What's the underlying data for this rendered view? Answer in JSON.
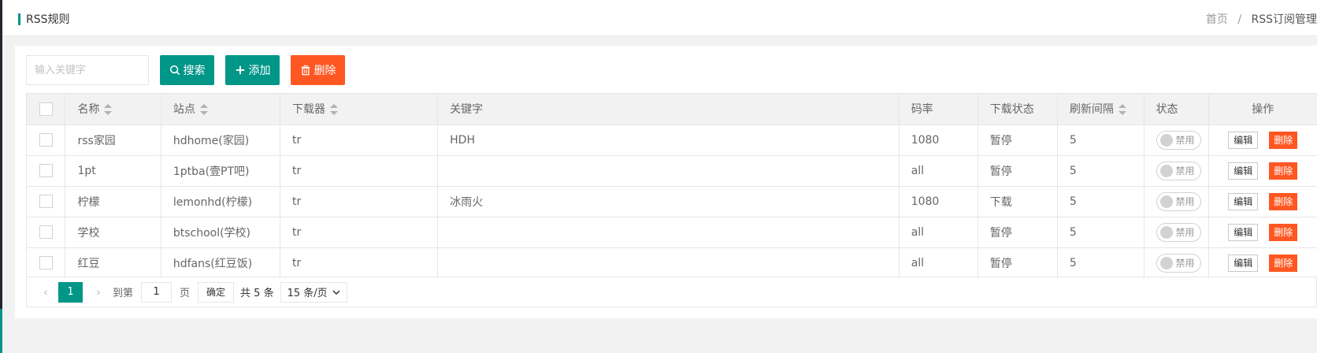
{
  "header": {
    "title": "RSS规则",
    "breadcrumb": [
      "首页",
      "RSS订阅管理"
    ],
    "separator": "/"
  },
  "toolbar": {
    "search_placeholder": "输入关键字",
    "search_label": "搜索",
    "add_label": "添加",
    "delete_label": "删除"
  },
  "table": {
    "columns": [
      "名称",
      "站点",
      "下载器",
      "关键字",
      "码率",
      "下载状态",
      "刷新间隔",
      "状态",
      "操作"
    ],
    "rows": [
      {
        "name": "rss家园",
        "site": "hdhome(家园)",
        "downloader": "tr",
        "keyword": "HDH",
        "bitrate": "1080",
        "dl_status": "暂停",
        "interval": "5",
        "status": "禁用",
        "edit": "编辑",
        "remove": "删除"
      },
      {
        "name": "1pt",
        "site": "1ptba(壹PT吧)",
        "downloader": "tr",
        "keyword": "",
        "bitrate": "all",
        "dl_status": "暂停",
        "interval": "5",
        "status": "禁用",
        "edit": "编辑",
        "remove": "删除"
      },
      {
        "name": "柠檬",
        "site": "lemonhd(柠檬)",
        "downloader": "tr",
        "keyword": "冰雨火",
        "bitrate": "1080",
        "dl_status": "下载",
        "interval": "5",
        "status": "禁用",
        "edit": "编辑",
        "remove": "删除"
      },
      {
        "name": "学校",
        "site": "btschool(学校)",
        "downloader": "tr",
        "keyword": "",
        "bitrate": "all",
        "dl_status": "暂停",
        "interval": "5",
        "status": "禁用",
        "edit": "编辑",
        "remove": "删除"
      },
      {
        "name": "红豆",
        "site": "hdfans(红豆饭)",
        "downloader": "tr",
        "keyword": "",
        "bitrate": "all",
        "dl_status": "暂停",
        "interval": "5",
        "status": "禁用",
        "edit": "编辑",
        "remove": "删除"
      }
    ]
  },
  "pager": {
    "current_page": "1",
    "goto_label": "到第",
    "goto_value": "1",
    "page_unit": "页",
    "confirm_label": "确定",
    "total_label": "共 5 条",
    "page_size": "15 条/页"
  },
  "colors": {
    "primary": "#009688",
    "danger": "#ff5722",
    "header_bg": "#f2f2f2"
  }
}
